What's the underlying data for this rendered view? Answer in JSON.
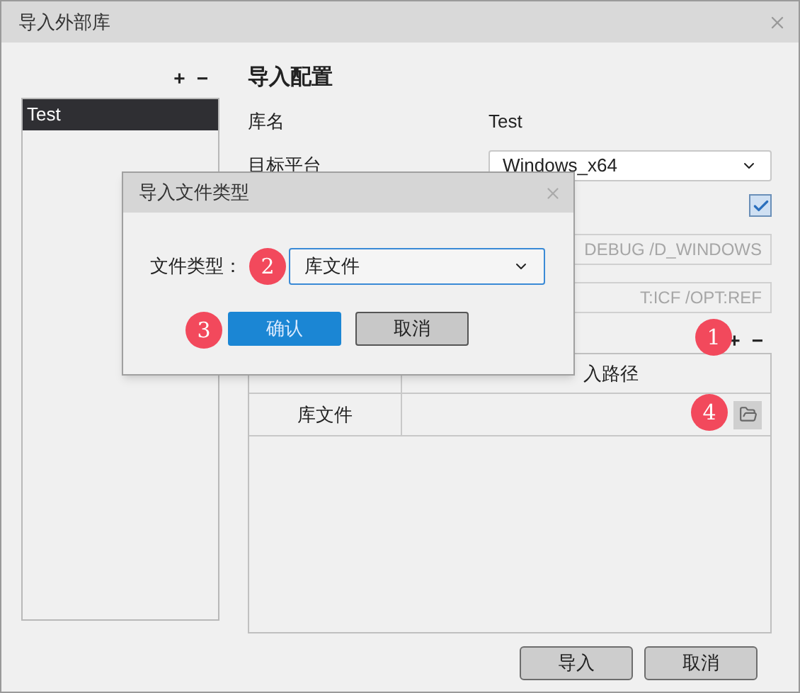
{
  "window": {
    "title": "导入外部库"
  },
  "library_list": {
    "add": "+",
    "remove": "−",
    "items": [
      {
        "label": "Test",
        "selected": true
      }
    ]
  },
  "config": {
    "heading": "导入配置",
    "fields": [
      {
        "kind": "text",
        "label": "库名",
        "value": "Test"
      },
      {
        "kind": "select",
        "label": "目标平台",
        "value": "Windows_x64"
      },
      {
        "kind": "checkbox",
        "checked": true
      },
      {
        "kind": "input",
        "value": "DEBUG /D_WINDOWS"
      },
      {
        "kind": "input",
        "value": "T:ICF /OPT:REF"
      }
    ]
  },
  "files": {
    "add": "+",
    "remove": "−",
    "header_column_2": "入路径",
    "rows": [
      {
        "column_1": "库文件"
      }
    ]
  },
  "buttons": [
    "导入",
    "取消"
  ],
  "dialog": {
    "title": "导入文件类型",
    "label": "文件类型：",
    "value": "库文件",
    "buttons": [
      {
        "label": "确认",
        "primary": true
      },
      {
        "label": "取消",
        "primary": false
      }
    ]
  },
  "markers": [
    "1",
    "2",
    "3",
    "4"
  ]
}
